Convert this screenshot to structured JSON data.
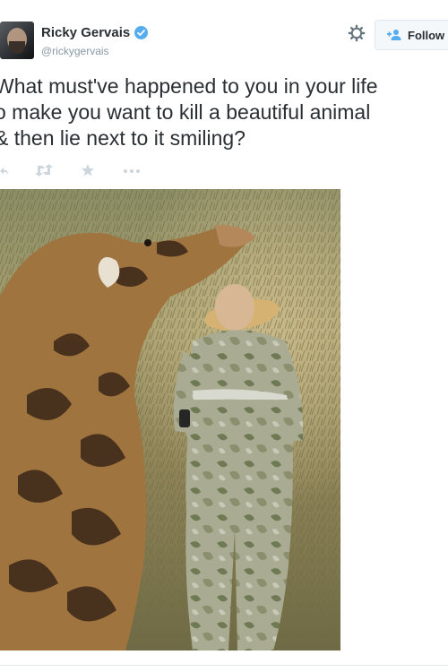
{
  "tweet": {
    "author": {
      "name": "Ricky Gervais",
      "handle": "@rickygervais",
      "verified": true
    },
    "follow_label": "Follow",
    "text": "What must've happened to you in your life\no make you want to kill a beautiful animal\n& then lie next to it smiling?",
    "actions": [
      "reply-icon",
      "retweet-icon",
      "favorite-icon",
      "more-icon"
    ],
    "colors": {
      "verified": "#55acee",
      "muted": "#8899a6",
      "text": "#292f33"
    }
  }
}
